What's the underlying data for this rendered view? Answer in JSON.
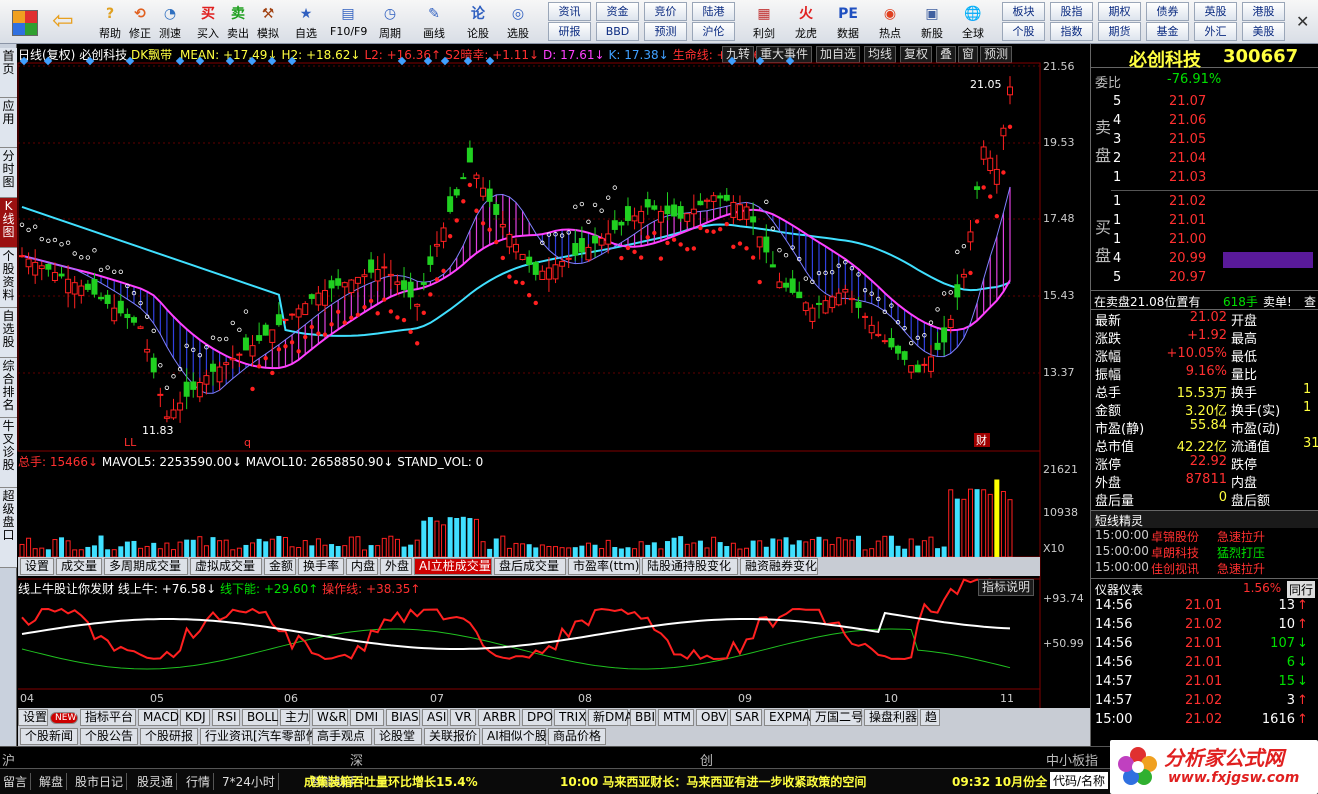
{
  "toolbar": {
    "top": [
      "帮助",
      "修正",
      "测速",
      "买入",
      "卖出",
      "模拟",
      "自选",
      "F10/F9",
      "周期",
      "画线",
      "论股",
      "选股",
      "",
      "利剑",
      "龙虎",
      "数据",
      "热点",
      "新股",
      "全球"
    ],
    "right": [
      "资讯",
      "资金",
      "竞价",
      "陆港",
      "研报",
      "BBD",
      "预测",
      "沪伦",
      "板块",
      "股指",
      "期权",
      "债券",
      "英股",
      "港股",
      "个股",
      "指数",
      "期货",
      "基金",
      "外汇",
      "美股"
    ]
  },
  "lefttabs": [
    "首页",
    "应用",
    "分时图",
    "K线图",
    "个股资料",
    "自选股",
    "综合排名",
    "牛叉诊股",
    "超级盘口"
  ],
  "chart": {
    "period": "日线(复权)",
    "stock": "必创科技",
    "ind_name": "DK飘带",
    "indicators": [
      {
        "t": "MEAN: +17.49↓",
        "c": "#ffff40"
      },
      {
        "t": "H2: +18.62↓",
        "c": "#ffff40"
      },
      {
        "t": "L2: +16.36↑",
        "c": "#ff3030"
      },
      {
        "t": "S2暗幸: +1.11↓",
        "c": "#ff3030"
      },
      {
        "t": "D: 17.61↓",
        "c": "#ff40ff"
      },
      {
        "t": "K: 17.38↓",
        "c": "#40a0ff"
      },
      {
        "t": "生命线: +16.96↑",
        "c": "#ff3030"
      }
    ],
    "buttons": [
      "九转",
      "重大事件",
      "加自选",
      "均线",
      "复权",
      "叠",
      "窗",
      "预测"
    ],
    "yaxis": [
      "21.56",
      "19.53",
      "17.48",
      "15.43",
      "13.37"
    ],
    "high_label": "21.05",
    "low_label": "11.83",
    "ll": "LL",
    "q": "q",
    "cai": "财"
  },
  "volume": {
    "label": "总手: 15466↓",
    "mavol5": "MAVOL5: 2253590.00↓",
    "mavol10": "MAVOL10: 2658850.90↓",
    "stand": "STAND_VOL: 0",
    "yaxis": [
      "21621",
      "10938",
      "X10"
    ]
  },
  "tabs1": [
    "设置",
    "成交量",
    "多周期成交量",
    "虚拟成交量",
    "金额",
    "换手率",
    "内盘",
    "外盘",
    "AI立桩成交量",
    "盘后成交量",
    "市盈率(ttm)",
    "陆股通持股变化",
    "融资融券变化"
  ],
  "osc": {
    "title": "线上牛股让你发财",
    "l1": "线上牛: +76.58↓",
    "l2": "线下能: +29.60↑",
    "l3": "操作线: +38.35↑",
    "btn": "指标说明",
    "yaxis": [
      "+93.74",
      "+50.99"
    ]
  },
  "months": [
    "04",
    "05",
    "06",
    "07",
    "08",
    "09",
    "10",
    "11"
  ],
  "tabs2": [
    "设置",
    "NEW",
    "指标平台",
    "MACD",
    "KDJ",
    "RSI",
    "BOLL",
    "主力",
    "W&R",
    "DMI",
    "BIAS",
    "ASI",
    "VR",
    "ARBR",
    "DPO",
    "TRIX",
    "新DMA",
    "BBI",
    "MTM",
    "OBV",
    "SAR",
    "EXPMA",
    "万国二号",
    "操盘利器",
    "趋"
  ],
  "news": [
    "个股新闻",
    "个股公告",
    "个股研报",
    "行业资讯[汽车零部件]",
    "高手观点",
    "论股堂",
    "关联报价",
    "AI相似个股",
    "商品价格"
  ],
  "idx": [
    "沪",
    "深",
    "创",
    "中小板指"
  ],
  "status": {
    "items": [
      "留言",
      "解盘",
      "股市日记",
      "股灵通",
      "行情",
      "7*24小时",
      "智能助手"
    ],
    "news1": "成集装箱吞吐量环比增长15.4%",
    "news2": "10:00 马来西亚财长：马来西亚有进一步收紧政策的空间",
    "time": "09:32 10月份全",
    "right": "代码/名称"
  },
  "quote": {
    "name": "必创科技",
    "code": "300667",
    "weibi_label": "委比",
    "weibi": "-76.91%",
    "sell": [
      [
        "5",
        "21.07",
        ""
      ],
      [
        "4",
        "21.06",
        ""
      ],
      [
        "3",
        "21.05",
        ""
      ],
      [
        "2",
        "21.04",
        ""
      ],
      [
        "1",
        "21.03",
        ""
      ]
    ],
    "buy": [
      [
        "1",
        "21.02",
        ""
      ],
      [
        "1",
        "21.01",
        ""
      ],
      [
        "1",
        "21.00",
        ""
      ],
      [
        "4",
        "20.99",
        ""
      ],
      [
        "5",
        "20.97",
        ""
      ]
    ],
    "sell_label": "卖盘",
    "buy_label": "买盘",
    "info": "在卖盘21.08位置有",
    "info_qty": "618手",
    "info_tail": "卖单!",
    "info_extra": "查",
    "stats": [
      [
        "最新",
        "21.02",
        "开盘",
        ""
      ],
      [
        "涨跌",
        "+1.92",
        "最高",
        ""
      ],
      [
        "涨幅",
        "+10.05%",
        "最低",
        ""
      ],
      [
        "振幅",
        "9.16%",
        "量比",
        ""
      ],
      [
        "总手",
        "15.53万",
        "换手",
        "1"
      ],
      [
        "金额",
        "3.20亿",
        "换手(实)",
        "1"
      ],
      [
        "市盈(静)",
        "55.84",
        "市盈(动)",
        ""
      ],
      [
        "总市值",
        "42.22亿",
        "流通值",
        "31"
      ],
      [
        "涨停",
        "22.92",
        "跌停",
        ""
      ],
      [
        "外盘",
        "87811",
        "内盘",
        ""
      ],
      [
        "盘后量",
        "0",
        "盘后额",
        ""
      ]
    ],
    "jx_title": "短线精灵",
    "jx": [
      [
        "15:00:00",
        "卓锦股份",
        "急速拉升"
      ],
      [
        "15:00:00",
        "卓朗科技",
        "猛烈打压"
      ],
      [
        "15:00:00",
        "佳创视讯",
        "急速拉升"
      ]
    ],
    "yb_title": "仪器仪表",
    "yb_pct": "1.56%",
    "yb_tab": "同行",
    "ticks": [
      [
        "14:56",
        "21.01",
        "13",
        "↑"
      ],
      [
        "14:56",
        "21.02",
        "10",
        "↑"
      ],
      [
        "14:56",
        "21.01",
        "107",
        "↓"
      ],
      [
        "14:56",
        "21.01",
        "6",
        "↓"
      ],
      [
        "14:57",
        "21.01",
        "15",
        "↓"
      ],
      [
        "14:57",
        "21.02",
        "3",
        "↑"
      ],
      [
        "15:00",
        "21.02",
        "1616",
        "↑"
      ]
    ]
  },
  "watermark": {
    "cn": "分析家公式网",
    "url": "www.fxjgsw.com"
  }
}
